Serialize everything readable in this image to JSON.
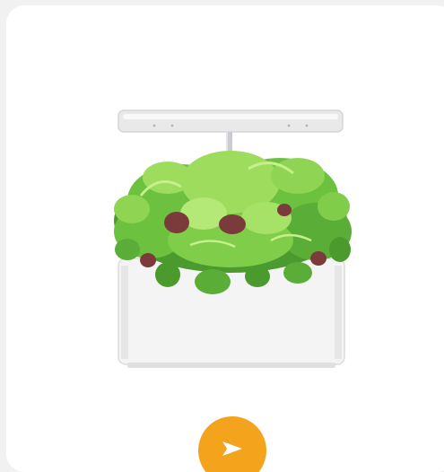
{
  "product": {
    "image_icon": "hydroponic-garden-product-image",
    "colors": {
      "lamp": "#e9e9e9",
      "pole": "#c9ccd0",
      "planter": "#f4f4f4",
      "leaf_dark": "#4a9a2e",
      "leaf_mid": "#6cc23e",
      "leaf_light": "#9ddc5c",
      "leaf_red": "#7b3b3b"
    }
  },
  "action_button": {
    "icon": "send-arrow-icon",
    "color": "#f4a31d"
  }
}
